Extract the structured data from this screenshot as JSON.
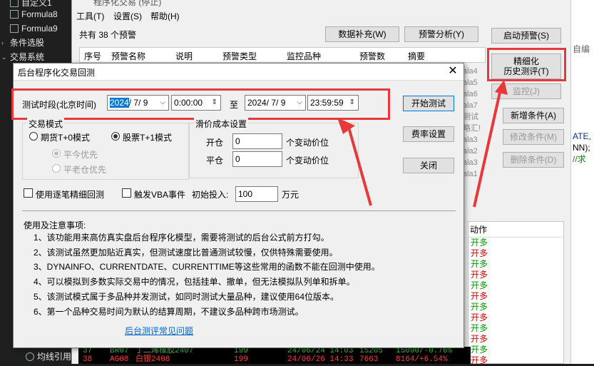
{
  "left_panel": {
    "items": [
      {
        "label": "自定义1"
      },
      {
        "label": "Formula8"
      },
      {
        "label": "Formula9"
      },
      {
        "label": "条件选股"
      },
      {
        "label": "交易系统"
      },
      {
        "label": "均线引用"
      }
    ]
  },
  "bg_window": {
    "title": "程序化交易 (停止)",
    "menu": [
      "工具(T)",
      "设置(S)",
      "帮助(H)"
    ],
    "count_text": "共有 38 个预警",
    "buttons": {
      "data_supplement": "数据补充(W)",
      "alert_analysis": "预警分析(Y)",
      "start_alert": "启动预警(S)",
      "refined_line1": "精细化",
      "refined_line2": "历史测评(T)",
      "monitor": "监控(J)",
      "new_condition": "新增条件(A)",
      "modify_condition": "修改条件(M)",
      "delete_condition": "删除条件(D)"
    },
    "table_headers": [
      "序号",
      "预警名称",
      "说明",
      "预警类型",
      "监控品种",
      "预警数",
      "摘要"
    ],
    "side_labels": [
      "ala4",
      "ala5",
      "ala6",
      "ala7",
      "测试",
      "略汇!",
      "ala3",
      "ala2",
      "ala3",
      "ala1"
    ],
    "action_header": "动作",
    "actions": [
      "开多",
      "开多",
      "开多",
      "开多",
      "开多",
      "开多",
      "开多",
      "开多",
      "开多",
      "开多",
      "开多",
      "开多"
    ],
    "bottom_rows": [
      {
        "no": "37",
        "code": "BR07",
        "name": "丁二烯橡胶2407",
        "num": "199",
        "date": "24/06/24 14:03",
        "price": "15205",
        "summary": "15090/-0.76%"
      },
      {
        "no": "38",
        "code": "AG08",
        "name": "白银2408",
        "num": "199",
        "date": "24/06/26 14:33",
        "price": "7663",
        "summary": "8164/+6.54%"
      }
    ]
  },
  "code_strip": {
    "lines": [
      "自编",
      "ATE,",
      "NN);",
      "//求"
    ]
  },
  "dialog": {
    "title": "后台程序化交易回测",
    "close_symbol": "✕",
    "test_period_label": "测试时段(北京时间)",
    "start_date_year": "2024",
    "start_date_rest": "/ 7/ 9",
    "start_time": "0:00:00",
    "to_label": "至",
    "end_date": "2024/ 7/ 9",
    "end_time": "23:59:59",
    "trade_mode_title": "交易模式",
    "futures_mode": "期货T+0模式",
    "stock_mode": "股票T+1模式",
    "close_today_first": "平今优先",
    "close_old_first": "平老仓优先",
    "slippage_title": "滑价成本设置",
    "open_label": "开仓",
    "open_value": "0",
    "close_label": "平仓",
    "close_value": "0",
    "tick_unit": "个变动价位",
    "use_detail_label": "使用逐笔精细回测",
    "trigger_vba_label": "触发VBA事件",
    "initial_invest_label": "初始投入:",
    "initial_invest_value": "100",
    "invest_unit": "万元",
    "btn_start": "开始测试",
    "btn_fee": "费率设置",
    "btn_close": "关闭",
    "notes_title": "使用及注意事项:",
    "notes": [
      "1、该功能用来高仿真实盘后台程序化模型，需要将测试的后台公式前方打勾。",
      "2、该测试虽然更加贴近真实，但测试速度比普通测试较慢，仅供特殊需要使用。",
      "3、DYNAINFO、CURRENTDATE、CURRENTTIME等这些常用的函数不能在回测中使用。",
      "4、可以模拟到多数实际交易中的情况，包括挂单、撤单，但无法模拟队列单和拆单。",
      "5、该测试模式属于多品种并发测试，如同时测试大量品种，建议使用64位版本。",
      "6、第一个品种交易时间为默认的结算周期，不建议多品种跨市场测试。"
    ],
    "faq_link": "后台测评常见问题"
  },
  "colors": {
    "highlight_red": "#e8393a",
    "action_red": "#d40000",
    "action_green": "#009900",
    "selection_blue": "#0078d7"
  }
}
